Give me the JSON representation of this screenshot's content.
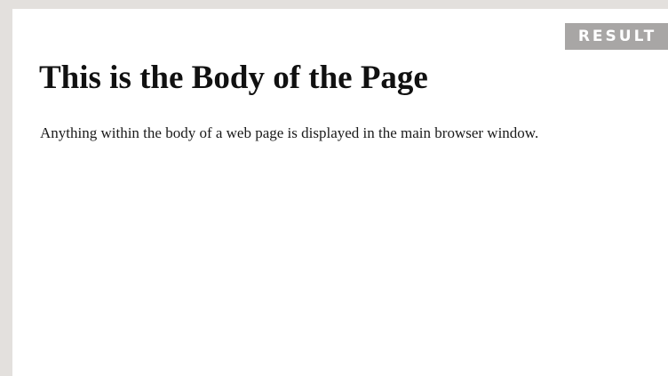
{
  "result_tab": {
    "label": "RESULT"
  },
  "page": {
    "heading": "This is the Body of the Page",
    "paragraph": "Anything within the body of a web page is displayed in the main browser window."
  }
}
